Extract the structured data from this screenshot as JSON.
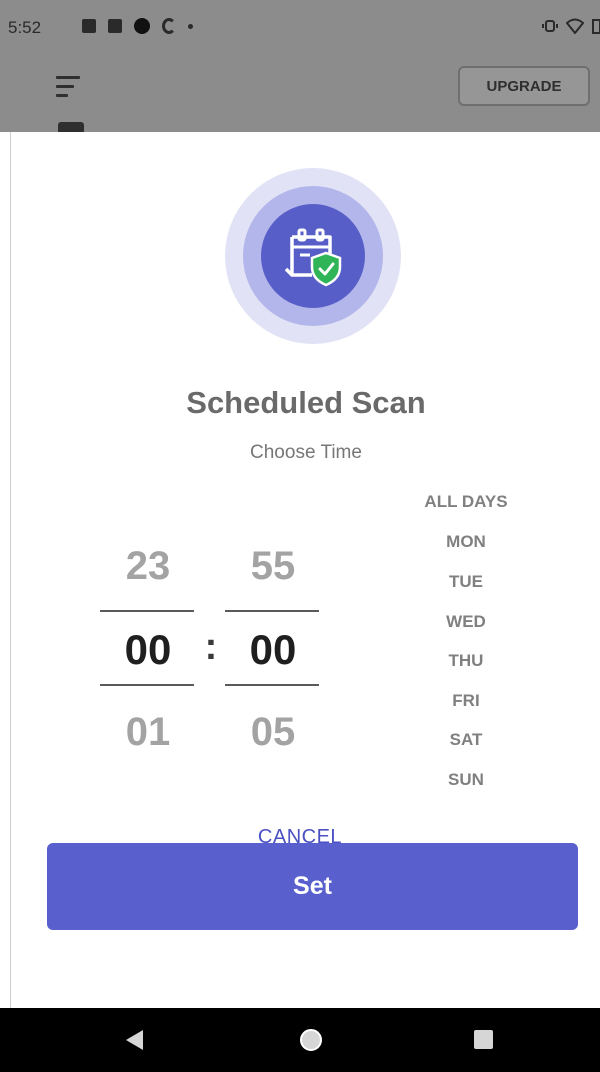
{
  "status_bar": {
    "time": "5:52",
    "left_icons": [
      "image-icon",
      "gallery-icon",
      "circle-icon",
      "c-icon",
      "dot-icon"
    ],
    "right_icons": [
      "vibrate-icon",
      "wifi-icon",
      "battery-icon"
    ]
  },
  "header": {
    "upgrade_label": "UPGRADE"
  },
  "dialog": {
    "title": "Scheduled Scan",
    "subtitle": "Choose Time",
    "icon": "calendar-shield-icon",
    "colors": {
      "accent": "#5960cd",
      "ring_outer": "#e1e2f5",
      "ring_mid": "#b3b6ea",
      "shield": "#2fb457"
    },
    "hours": {
      "prev": "23",
      "current": "00",
      "next": "01"
    },
    "separator": ":",
    "minutes": {
      "prev": "55",
      "current": "00",
      "next": "05"
    },
    "days": [
      "ALL DAYS",
      "MON",
      "TUE",
      "WED",
      "THU",
      "FRI",
      "SAT",
      "SUN"
    ],
    "set_label": "Set",
    "cancel_label": "CANCEL"
  },
  "nav_bar": {
    "icons": [
      "back-icon",
      "home-icon",
      "recents-icon"
    ]
  }
}
